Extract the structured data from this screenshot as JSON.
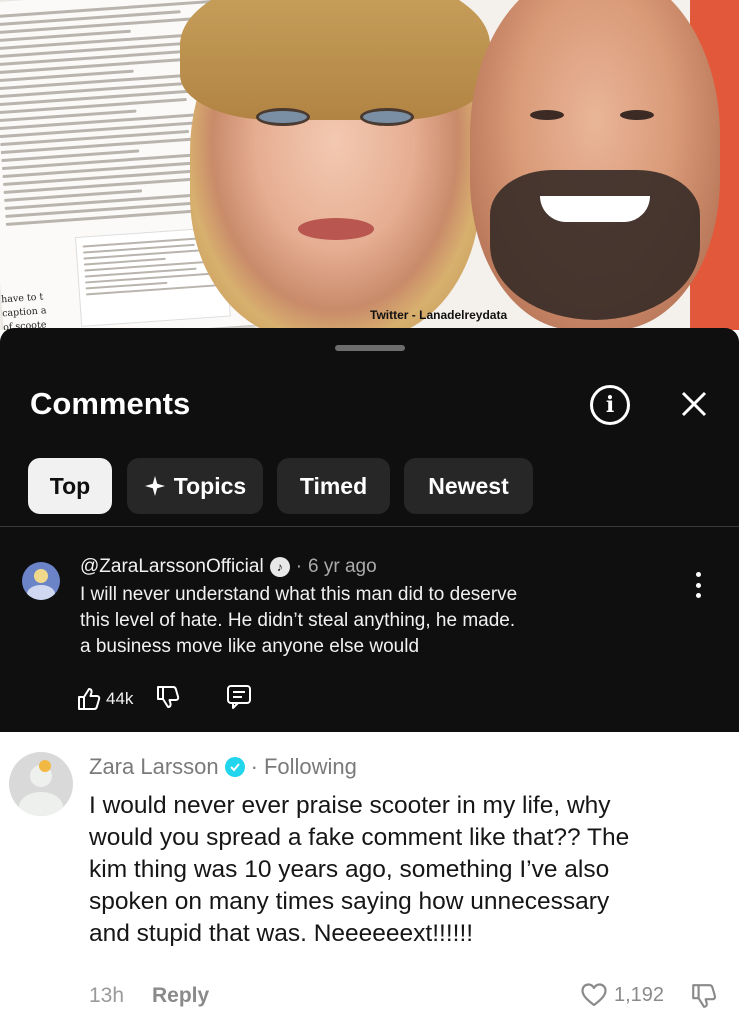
{
  "video": {
    "watermark": "Twitter - Lanadelreydata",
    "doc_snippets": [
      "have to t",
      "caption a",
      "of scoote"
    ]
  },
  "comments_panel": {
    "title": "Comments",
    "info_icon": "info-icon",
    "close_icon": "close-icon",
    "sort_chips": [
      {
        "label": "Top",
        "active": true
      },
      {
        "label": "Topics",
        "icon": "sparkle-icon",
        "active": false
      },
      {
        "label": "Timed",
        "active": false
      },
      {
        "label": "Newest",
        "active": false
      }
    ],
    "comment": {
      "author": "@ZaraLarssonOfficial",
      "badge_icon": "music-note-badge-icon",
      "time": "6 yr ago",
      "lines": [
        "I will never understand what this man did to deserve",
        "this level of hate. He didn’t steal anything, he made.",
        "a business move like anyone else would"
      ],
      "likes": "44k",
      "like_icon": "thumbs-up-icon",
      "dislike_icon": "thumbs-down-icon",
      "reply_icon": "reply-comment-icon",
      "menu_icon": "more-vertical-icon"
    }
  },
  "reply": {
    "author": "Zara Larsson",
    "verified_icon": "verified-icon",
    "relation": "Following",
    "lines": [
      "I would never ever praise scooter in my life, why",
      "would you spread a fake comment like that?? The",
      "kim thing was 10 years ago, something I’ve also",
      "spoken on many times saying how unnecessary",
      "and stupid that was. Neeeeeext!!!!!!"
    ],
    "time": "13h",
    "reply_label": "Reply",
    "likes": "1,192",
    "like_icon": "heart-icon",
    "dislike_icon": "thumbs-down-icon"
  },
  "colors": {
    "panel_bg": "#0f0f0f",
    "chip_bg": "#272727",
    "chip_active_bg": "#f1f1f1",
    "verified": "#20d5ec"
  }
}
